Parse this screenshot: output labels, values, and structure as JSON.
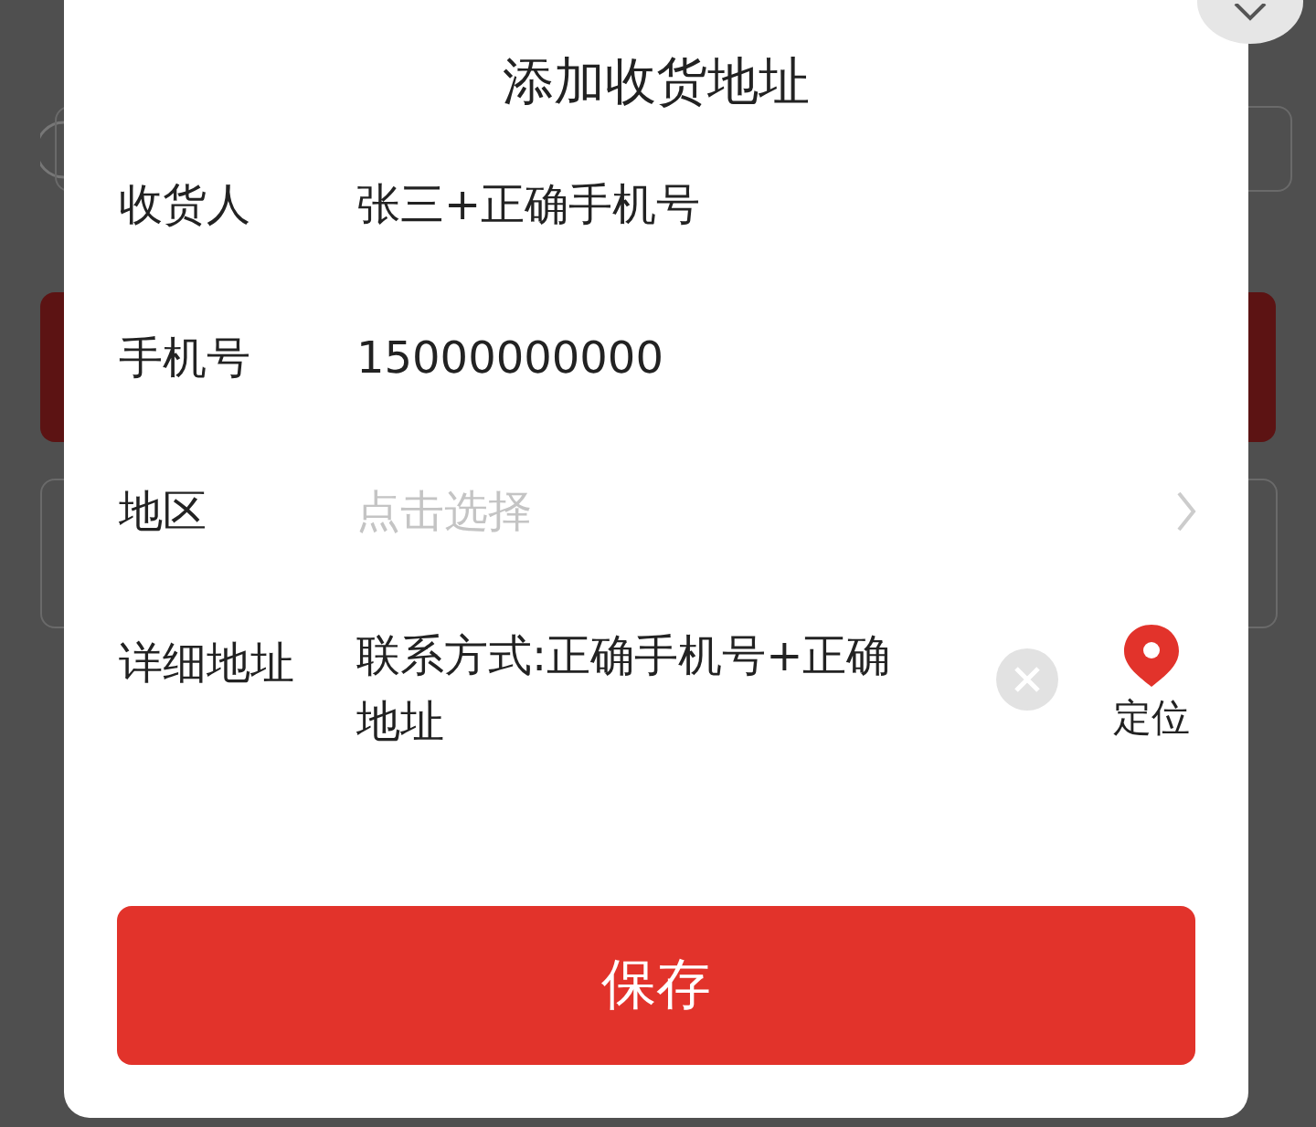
{
  "dialog": {
    "title": "添加收货地址"
  },
  "fields": [
    {
      "kind": "text",
      "label": "收货人",
      "value": "张三+正确手机号"
    },
    {
      "kind": "text",
      "label": "手机号",
      "value": "15000000000"
    },
    {
      "kind": "select",
      "label": "地区",
      "placeholder": "点击选择"
    },
    {
      "kind": "address",
      "label": "详细地址",
      "value": "联系方式:正确手机号+正确地址",
      "locate_label": "定位"
    }
  ],
  "save_button": "保存"
}
